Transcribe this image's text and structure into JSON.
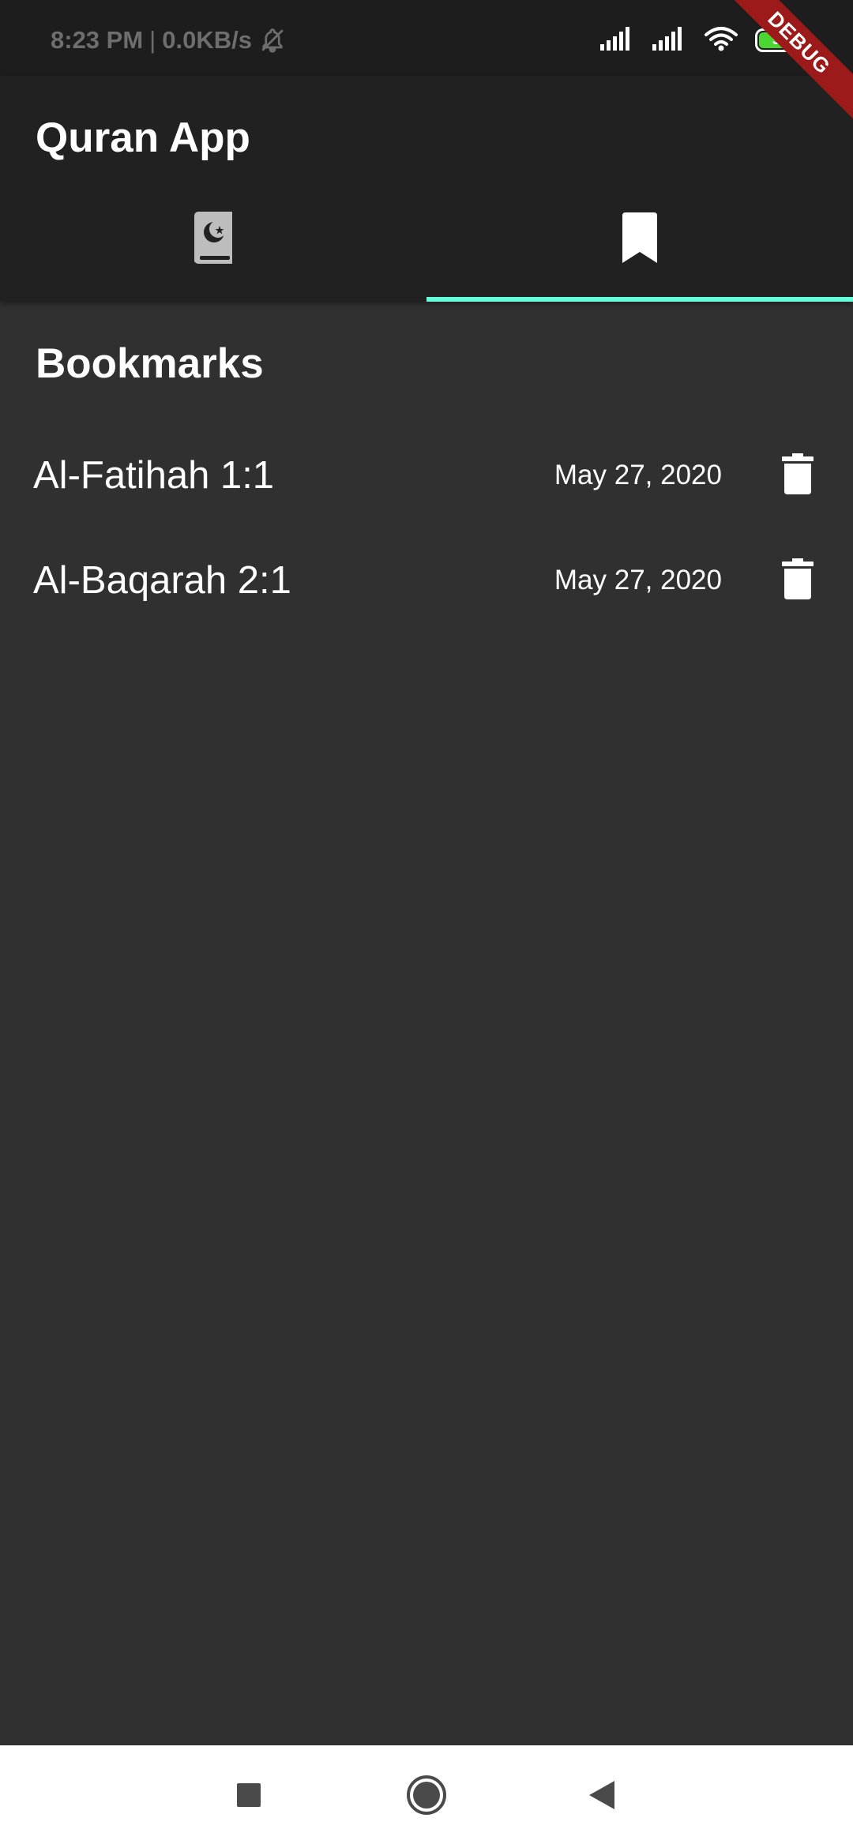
{
  "status_bar": {
    "time": "8:23 PM",
    "separator": "|",
    "network_speed": "0.0KB/s",
    "battery_level": "98",
    "battery_fraction": 0.98,
    "icons": [
      "bell-off-icon",
      "signal-icon",
      "signal-icon",
      "wifi-icon",
      "battery-icon"
    ]
  },
  "debug_banner": {
    "label": "DEBUG"
  },
  "app_bar": {
    "title": "Quran App",
    "tabs": [
      {
        "icon": "quran-book-icon",
        "selected": false
      },
      {
        "icon": "bookmark-icon",
        "selected": true
      }
    ]
  },
  "bookmarks": {
    "title": "Bookmarks",
    "items": [
      {
        "title": "Al-Fatihah 1:1",
        "date": "May 27, 2020",
        "action_icon": "trash-icon"
      },
      {
        "title": "Al-Baqarah 2:1",
        "date": "May 27, 2020",
        "action_icon": "trash-icon"
      }
    ]
  },
  "nav_bar": {
    "buttons": [
      "recents-square-icon",
      "home-circle-icon",
      "back-triangle-icon"
    ]
  },
  "colors": {
    "background": "#303030",
    "app_bar": "#212121",
    "status_bar": "#1d1d1d",
    "accent": "#64ffda",
    "tab_inactive": "#bdbdbd",
    "debug_ribbon": "#9c1a1a",
    "battery_green": "#4cd631"
  }
}
